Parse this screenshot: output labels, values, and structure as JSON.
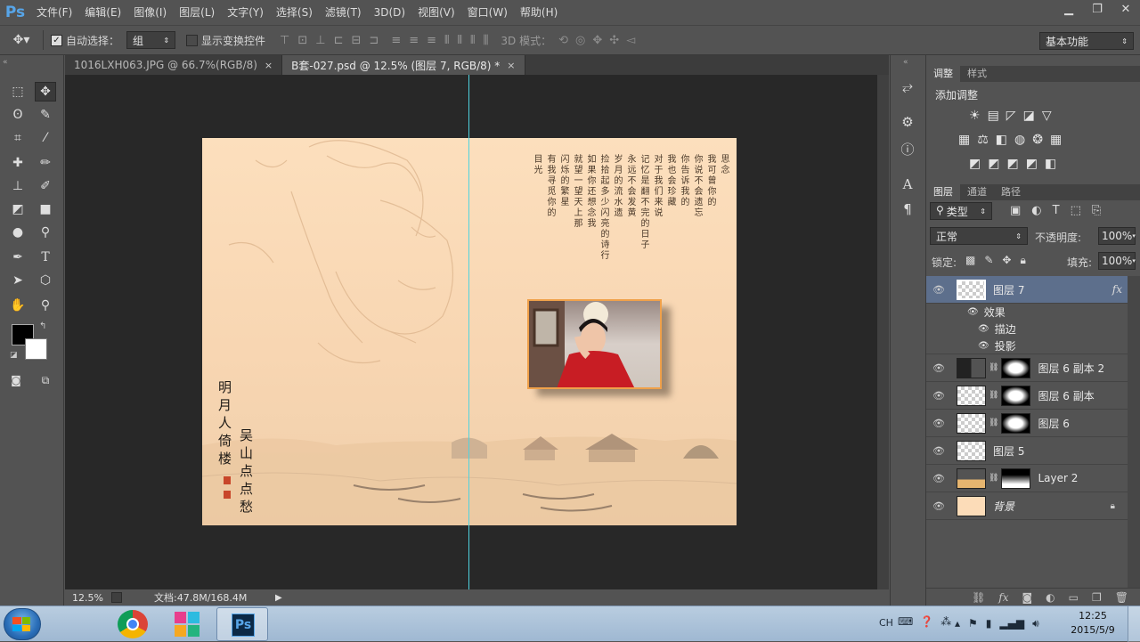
{
  "app": {
    "logo": "Ps"
  },
  "menu": [
    "文件(F)",
    "编辑(E)",
    "图像(I)",
    "图层(L)",
    "文字(Y)",
    "选择(S)",
    "滤镜(T)",
    "3D(D)",
    "视图(V)",
    "窗口(W)",
    "帮助(H)"
  ],
  "options": {
    "auto_select_label": "自动选择：",
    "auto_select_value": "组",
    "show_transform_label": "显示变换控件",
    "mode_3d_label": "3D 模式：",
    "workspace": "基本功能"
  },
  "tabs": [
    {
      "label": "1016LXH063.JPG @ 66.7%(RGB/8)",
      "close": "×"
    },
    {
      "label": "B套-027.psd @ 12.5% (图层 7, RGB/8) *",
      "close": "×"
    }
  ],
  "status": {
    "zoom": "12.5%",
    "doc": "文档:47.8M/168.4M"
  },
  "document": {
    "poem_columns": [
      "思念",
      "我可曾你的",
      "你说不会遗忘",
      "你告诉我的",
      "我也会珍藏",
      "对于我们来说",
      "记忆是翻不完的日子",
      "永远不会发黄",
      "岁月的流水遗",
      "捡拾起多少闪亮的诗行",
      "如果你还想念我",
      "就望一望天上那",
      "闪烁的繁星",
      "有我寻觅你的",
      "目光"
    ],
    "calligraphy_left": "明月人倚楼",
    "calligraphy_right": "吴山点点愁"
  },
  "right_panel": {
    "adjust_tabs": [
      "调整",
      "样式"
    ],
    "add_adjustment": "添加调整",
    "layer_tabs": [
      "图层",
      "通道",
      "路径"
    ],
    "filter_type": "类型",
    "blend_mode": "正常",
    "opacity_label": "不透明度:",
    "opacity": "100%",
    "lock_label": "锁定:",
    "fill_label": "填充:",
    "fill": "100%",
    "layers": [
      {
        "name": "图层 7",
        "fx": "fx"
      },
      {
        "name": "效果"
      },
      {
        "name": "描边"
      },
      {
        "name": "投影"
      },
      {
        "name": "图层 6 副本 2"
      },
      {
        "name": "图层 6 副本"
      },
      {
        "name": "图层 6"
      },
      {
        "name": "图层 5"
      },
      {
        "name": "Layer 2"
      },
      {
        "name": "背景"
      }
    ]
  },
  "taskbar": {
    "ime": "CH",
    "time": "12:25",
    "date": "2015/5/9"
  },
  "colors": {
    "ui_bg": "#535353",
    "canvas_bg": "#282828",
    "selected_layer": "#5d6f8c",
    "guide": "#4fd3df",
    "accent_blue": "#57a5e8"
  }
}
